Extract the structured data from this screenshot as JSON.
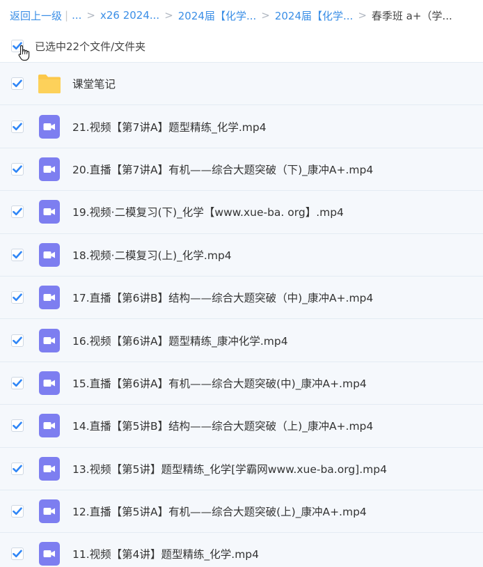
{
  "breadcrumb": {
    "back": "返回上一级",
    "bar": "|",
    "ellipsis": "...",
    "arrow": ">",
    "crumbs": [
      "x26 2024...",
      "2024届【化学...",
      "2024届【化学..."
    ],
    "current": "春季班 a+（学..."
  },
  "selection": {
    "label": "已选中22个文件/文件夹",
    "checked": true
  },
  "colors": {
    "link": "#3a8ee6",
    "checkbox": "#2f86f6",
    "folder": "#fcc84a",
    "video_icon": "#7d7ef0",
    "row_bg": "#f5f8fc"
  },
  "files": [
    {
      "name": "课堂笔记",
      "icon": "folder-icon",
      "checked": true
    },
    {
      "name": "21.视频【第7讲A】题型精练_化学.mp4",
      "icon": "video-file-icon",
      "checked": true
    },
    {
      "name": "20.直播【第7讲A】有机——综合大题突破（下)_康冲A+.mp4",
      "icon": "video-file-icon",
      "checked": true
    },
    {
      "name": "19.视频·二模复习(下)_化学【www.xue-ba. org】.mp4",
      "icon": "video-file-icon",
      "checked": true
    },
    {
      "name": "18.视频·二模复习(上)_化学.mp4",
      "icon": "video-file-icon",
      "checked": true
    },
    {
      "name": "17.直播【第6讲B】结构——综合大题突破（中)_康冲A+.mp4",
      "icon": "video-file-icon",
      "checked": true
    },
    {
      "name": "16.视频【第6讲A】题型精练_康冲化学.mp4",
      "icon": "video-file-icon",
      "checked": true
    },
    {
      "name": "15.直播【第6讲A】有机——综合大题突破(中)_康冲A+.mp4",
      "icon": "video-file-icon",
      "checked": true
    },
    {
      "name": "14.直播【第5讲B】结构——综合大题突破（上)_康冲A+.mp4",
      "icon": "video-file-icon",
      "checked": true
    },
    {
      "name": "13.视频【第5讲】题型精练_化学[学霸网www.xue-ba.org].mp4",
      "icon": "video-file-icon",
      "checked": true
    },
    {
      "name": "12.直播【第5讲A】有机——综合大题突破(上)_康冲A+.mp4",
      "icon": "video-file-icon",
      "checked": true
    },
    {
      "name": "11.视频【第4讲】题型精练_化学.mp4",
      "icon": "video-file-icon",
      "checked": true
    }
  ]
}
